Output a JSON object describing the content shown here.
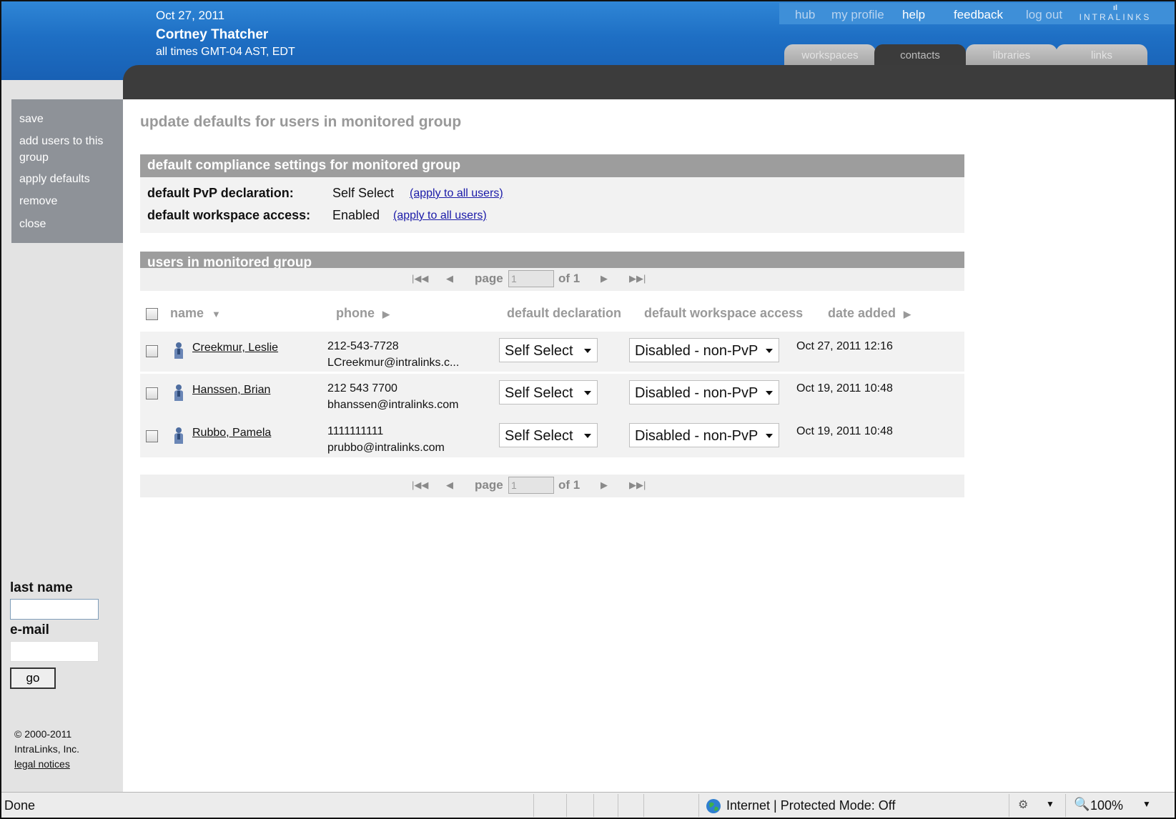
{
  "header": {
    "date": "Oct 27, 2011",
    "user_name": "Cortney Thatcher",
    "timezone": "all times  GMT-04 AST, EDT",
    "util_links": [
      "hub",
      "my profile",
      "help",
      "feedback",
      "log out"
    ],
    "logo_text": "INTRALINKS"
  },
  "tabs": [
    "workspaces",
    "contacts",
    "libraries",
    "links"
  ],
  "active_tab": "contacts",
  "sidebar": {
    "menu": [
      "save",
      "add users to this group",
      "apply defaults",
      "remove",
      "close"
    ],
    "last_name_label": "last name",
    "email_label": "e-mail",
    "go_label": "go",
    "copyright_line1": "© 2000-2011",
    "copyright_line2": "IntraLinks, Inc.",
    "legal_link": "legal notices"
  },
  "main": {
    "title": "update defaults for users in monitored group",
    "compliance_header": "default compliance settings for monitored group",
    "pvp_label": "default PvP declaration:",
    "pvp_value": "Self Select",
    "workspace_label": "default workspace access:",
    "workspace_value": "Enabled",
    "apply_link": "(apply to all users)",
    "users_header": "users in monitored group",
    "pager": {
      "page_label": "page",
      "page_value": "1",
      "of_label": "of 1"
    },
    "columns": {
      "name": "name",
      "phone": "phone",
      "declaration": "default declaration",
      "access": "default workspace access",
      "date": "date added"
    },
    "users": [
      {
        "name": "Creekmur, Leslie",
        "phone": "212-543-7728",
        "email": "LCreekmur@intralinks.c...",
        "declaration": "Self Select",
        "access": "Disabled - non-PvP",
        "date_added": "Oct 27, 2011 12:16"
      },
      {
        "name": "Hanssen, Brian",
        "phone": "212 543 7700",
        "email": "bhanssen@intralinks.com",
        "declaration": "Self Select",
        "access": "Disabled - non-PvP",
        "date_added": "Oct 19, 2011 10:48"
      },
      {
        "name": "Rubbo, Pamela",
        "phone": "1111111111",
        "email": "prubbo@intralinks.com",
        "declaration": "Self Select",
        "access": "Disabled - non-PvP",
        "date_added": "Oct 19, 2011 10:48"
      }
    ]
  },
  "statusbar": {
    "status": "Done",
    "zone": "Internet | Protected Mode: Off",
    "zoom": "100%"
  }
}
